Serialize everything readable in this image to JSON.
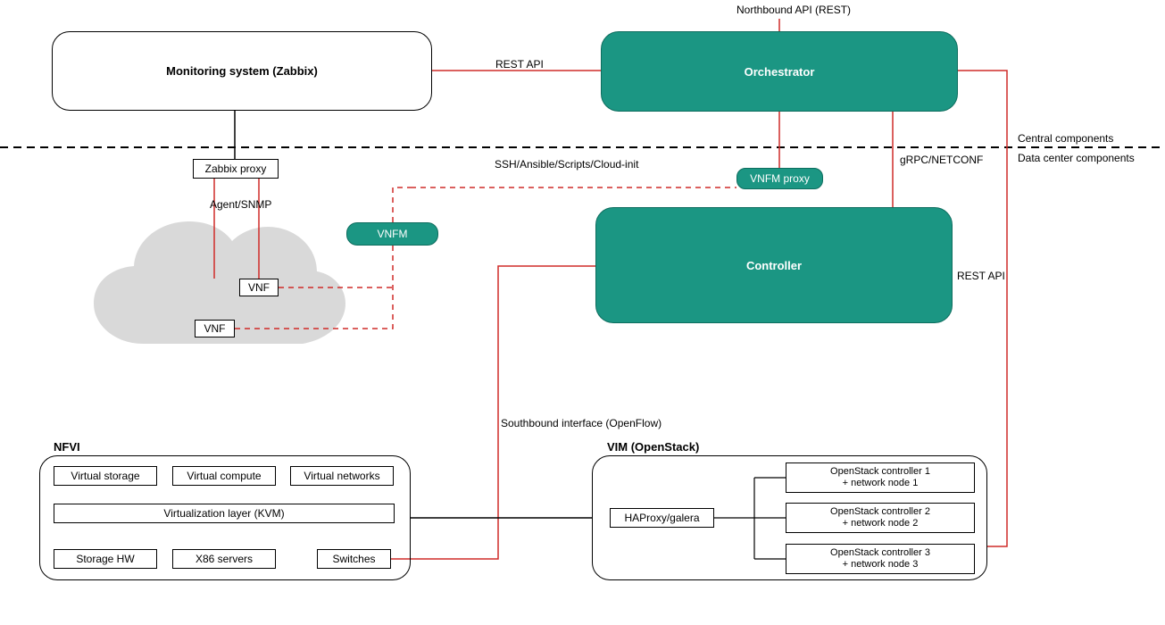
{
  "nodes": {
    "monitoring": {
      "label": "Monitoring system (Zabbix)"
    },
    "orchestrator": {
      "label": "Orchestrator"
    },
    "zabbix_proxy": {
      "label": "Zabbix proxy"
    },
    "vnfm_proxy": {
      "label": "VNFM proxy"
    },
    "vnfm": {
      "label": "VNFM"
    },
    "vnf1": {
      "label": "VNF"
    },
    "vnf2": {
      "label": "VNF"
    },
    "controller": {
      "label": "Controller"
    },
    "nfvi_title": {
      "label": "NFVI"
    },
    "vstorage": {
      "label": "Virtual storage"
    },
    "vcompute": {
      "label": "Virtual compute"
    },
    "vnetworks": {
      "label": "Virtual networks"
    },
    "virt_layer": {
      "label": "Virtualization layer (KVM)"
    },
    "storage_hw": {
      "label": "Storage HW"
    },
    "x86": {
      "label": "X86 servers"
    },
    "switches": {
      "label": "Switches"
    },
    "vim_title": {
      "label": "VIM (OpenStack)"
    },
    "haproxy": {
      "label": "HAProxy/galera"
    },
    "os_ctrl1_a": {
      "label": "OpenStack controller 1"
    },
    "os_ctrl1_b": {
      "label": "+ network node 1"
    },
    "os_ctrl2_a": {
      "label": "OpenStack controller 2"
    },
    "os_ctrl2_b": {
      "label": "+ network node 2"
    },
    "os_ctrl3_a": {
      "label": "OpenStack controller 3"
    },
    "os_ctrl3_b": {
      "label": "+ network node 3"
    }
  },
  "edgelabels": {
    "northbound": "Northbound API (REST)",
    "rest_api_mid": "REST API",
    "central": "Central components",
    "datacenter": "Data center components",
    "agent_snmp": "Agent/SNMP",
    "ssh": "SSH/Ansible/Scripts/Cloud-init",
    "grpc": "gRPC/NETCONF",
    "rest_api_right": "REST API",
    "southbound": "Southbound interface (OpenFlow)"
  },
  "colors": {
    "teal": "#1b9683",
    "red": "#cf2b28",
    "black": "#000000",
    "cloud": "#d9d9d9"
  }
}
